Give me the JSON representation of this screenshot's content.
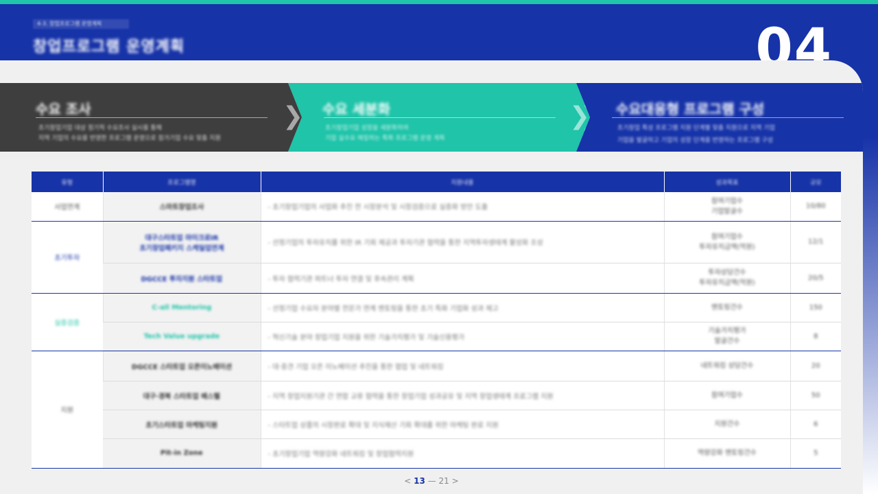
{
  "header": {
    "small_label": "4-3. 창업프로그램 운영계획",
    "title": "창업프로그램 운영계획",
    "section_number": "04"
  },
  "steps": [
    {
      "title": "수요 조사",
      "desc1": "초기창업기업 대상 정기적 수요조사 실시를 통해",
      "desc2": "지역 기업의 수요를 반영한 프로그램 운영으로 참가기업 수요 맞춤 지원"
    },
    {
      "title": "수요 세분화",
      "desc1": "초기창업기업 성장을 세분화하여",
      "desc2": "기업 실수요 매칭하는 특화 프로그램 운영 계획"
    },
    {
      "title": "수요대응형 프로그램 구성",
      "desc1": "초기창업 특성 프로그램 지원 단계별 맞춤 지원으로 지역 기업",
      "desc2": "기업을 발굴하고 기업의 성장 단계를 반영하는 프로그램 구성"
    }
  ],
  "table": {
    "headers": [
      "유형",
      "프로그램명",
      "지원내용",
      "성과목표",
      "규모"
    ],
    "rows": [
      {
        "category": "사업연계",
        "name": "스마트창업조사",
        "desc": "- 초기창업기업의 사업화 추진 전 시장분석 및 시장검증으로 실증화 방안 도출",
        "target1": "참여기업수",
        "target2": "기업발굴수",
        "size": "10/80"
      },
      {
        "category": "초기투자",
        "name": "대구스타트업 마이크로IR",
        "name2": "초기창업패키지 스케일업연계",
        "desc": "- 선정기업의 투자유치를 위한 IR 기회 제공과 투자기관 협력을 통한 지역투자생태계 활성화 조성",
        "target1": "참여기업수",
        "target2": "투자유치금액(억원)",
        "size": "12/1"
      },
      {
        "category": "",
        "name": "DGCCE 투자지원 스타트업",
        "desc": "- 투자 협력기관 파트너 투자 연결 및 후속관리 계획",
        "target1": "투자상담건수",
        "target2": "투자유치금액(억원)",
        "size": "20/5"
      },
      {
        "category": "실증검증",
        "name": "C-all Mentoring",
        "desc": "- 선정기업 수요자 분야별 전문가 연계 멘토링을 통한 초기 특화 기업화 성과 제고",
        "target1": "멘토링건수",
        "target2": "",
        "size": "150"
      },
      {
        "category": "",
        "name": "Tech Value upgrade",
        "desc": "- 혁신기술 분야 창업기업 지원을 위한 기술가치평가 및 기술신용평가",
        "target1": "기술가치평가",
        "target2": "발굴건수",
        "size": "8"
      },
      {
        "category": "지원",
        "name": "DGCCE 스타트업 오픈이노베이션",
        "desc": "- 대·중견 기업 오픈 이노베이션 추진을 통한 협업 및 네트워킹",
        "target1": "네트워킹 상담건수",
        "target2": "",
        "size": "20"
      },
      {
        "category": "",
        "name": "대구·경북 스타트업 배스텔",
        "desc": "- 지역 창업지원기관 간 연합 교류 협력을 통한 창업기업 성과공유 및 지역 창업생태계 프로그램 지원",
        "target1": "참여기업수",
        "target2": "",
        "size": "50"
      },
      {
        "category": "",
        "name": "초기스타트업 마케팅지원",
        "desc": "- 스타트업 상품의 시장판로 확대 및 지식재산 기회 확대를 위한 마케팅 판로 지원",
        "target1": "지원건수",
        "target2": "",
        "size": "6"
      },
      {
        "category": "",
        "name": "Pit-in Zone",
        "desc": "- 초기창업기업 역량강화 네트워킹 및 창업협력지원",
        "target1": "역량강화 멘토링건수",
        "target2": "",
        "size": "5"
      }
    ]
  },
  "pager": {
    "prev": "<",
    "current": "13",
    "sep": "—",
    "total": "21",
    "next": ">"
  },
  "colors": {
    "primary": "#1733a8",
    "accent": "#1fc4a9",
    "dark": "#3e3e3e",
    "background": "#f0f0f0"
  }
}
